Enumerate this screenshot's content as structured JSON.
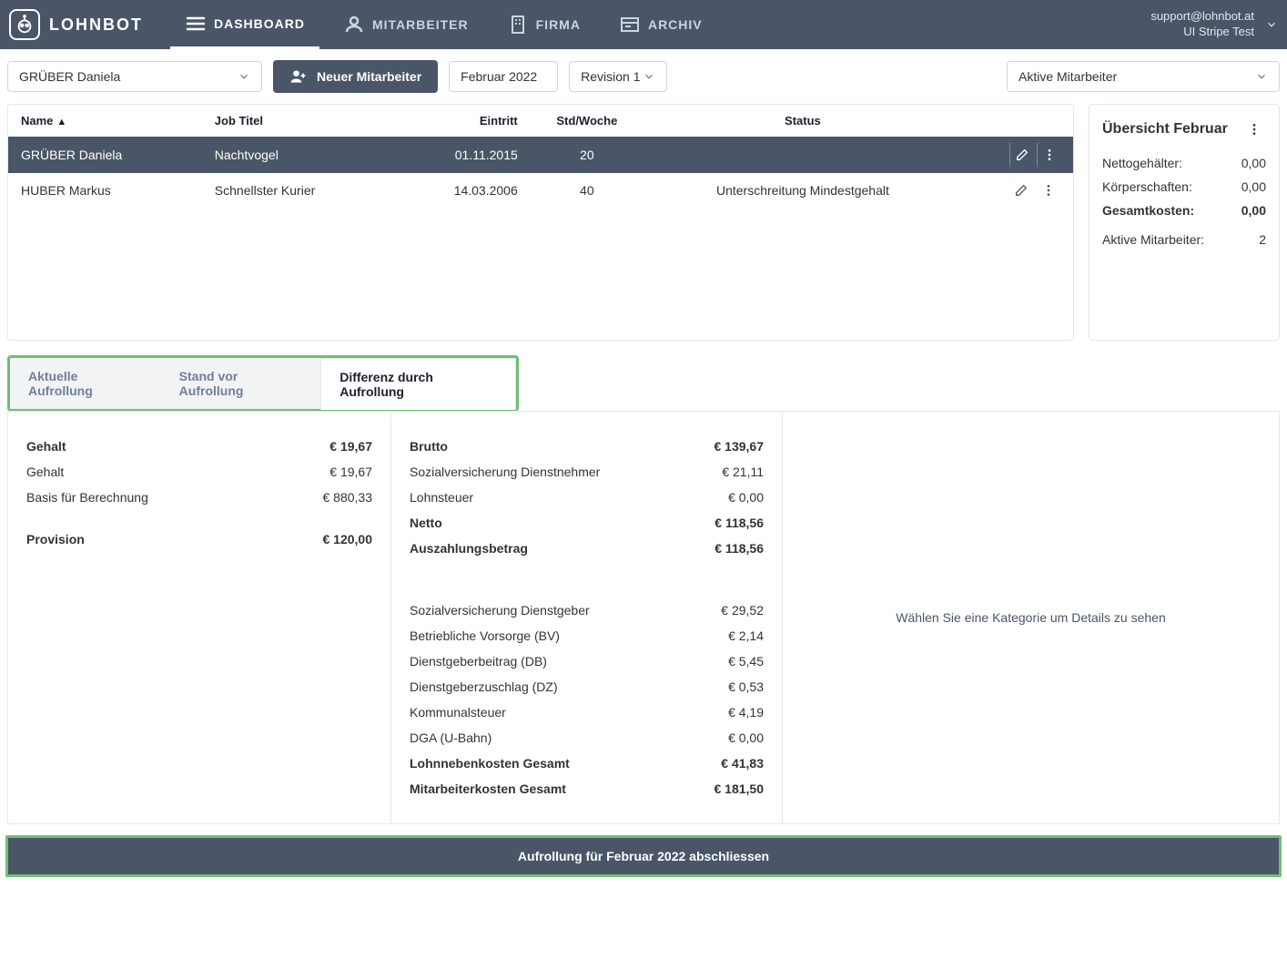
{
  "brand": "LOHNBOT",
  "nav": {
    "dashboard": "DASHBOARD",
    "mitarbeiter": "MITARBEITER",
    "firma": "FIRMA",
    "archiv": "ARCHIV"
  },
  "user": {
    "email": "support@lohnbot.at",
    "sub": "UI Stripe Test"
  },
  "toolbar": {
    "employee": "GRÜBER Daniela",
    "new_employee": "Neuer Mitarbeiter",
    "month": "Februar 2022",
    "revision": "Revision 1",
    "filter": "Aktive Mitarbeiter"
  },
  "table": {
    "headers": {
      "name": "Name",
      "job": "Job Titel",
      "eintritt": "Eintritt",
      "std": "Std/Woche",
      "status": "Status"
    },
    "rows": [
      {
        "name": "GRÜBER Daniela",
        "job": "Nachtvogel",
        "eintritt": "01.11.2015",
        "std": "20",
        "status": "",
        "selected": true
      },
      {
        "name": "HUBER Markus",
        "job": "Schnellster Kurier",
        "eintritt": "14.03.2006",
        "std": "40",
        "status": "Unterschreitung Mindestgehalt",
        "selected": false
      }
    ]
  },
  "overview": {
    "title": "Übersicht Februar",
    "netto_label": "Nettogehälter:",
    "netto": "0,00",
    "korp_label": "Körperschaften:",
    "korp": "0,00",
    "gesamt_label": "Gesamtkosten:",
    "gesamt": "0,00",
    "active_label": "Aktive Mitarbeiter:",
    "active": "2"
  },
  "tabs": {
    "t1": "Aktuelle Aufrollung",
    "t2": "Stand vor Aufrollung",
    "t3": "Differenz durch Aufrollung"
  },
  "left": {
    "gehalt_label": "Gehalt",
    "gehalt": "€ 19,67",
    "gehalt2_label": "Gehalt",
    "gehalt2": "€ 19,67",
    "basis_label": "Basis für Berechnung",
    "basis": "€ 880,33",
    "provision_label": "Provision",
    "provision": "€ 120,00"
  },
  "right": {
    "brutto_label": "Brutto",
    "brutto": "€ 139,67",
    "svdn_label": "Sozialversicherung Dienstnehmer",
    "svdn": "€ 21,11",
    "lst_label": "Lohnsteuer",
    "lst": "€ 0,00",
    "netto_label": "Netto",
    "netto": "€ 118,56",
    "ausz_label": "Auszahlungsbetrag",
    "ausz": "€ 118,56",
    "svdg_label": "Sozialversicherung Dienstgeber",
    "svdg": "€ 29,52",
    "bv_label": "Betriebliche Vorsorge (BV)",
    "bv": "€ 2,14",
    "db_label": "Dienstgeberbeitrag (DB)",
    "db": "€ 5,45",
    "dz_label": "Dienstgeberzuschlag (DZ)",
    "dz": "€ 0,53",
    "kommst_label": "Kommunalsteuer",
    "kommst": "€ 4,19",
    "dga_label": "DGA (U-Bahn)",
    "dga": "€ 0,00",
    "lnk_label": "Lohnnebenkosten Gesamt",
    "lnk": "€ 41,83",
    "mak_label": "Mitarbeiterkosten Gesamt",
    "mak": "€ 181,50"
  },
  "detail_hint": "Wählen Sie eine Kategorie um Details zu sehen",
  "footer": "Aufrollung für Februar 2022 abschliessen"
}
